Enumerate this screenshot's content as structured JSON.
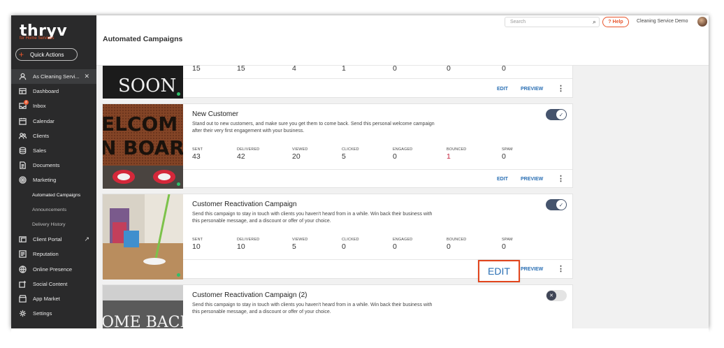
{
  "brand": {
    "name": "thryv",
    "sub": "for Home Services"
  },
  "quick_actions": "Quick Actions",
  "sidebar": {
    "items": [
      {
        "label": "As Cleaning Servi...",
        "icon": "user-switch-icon",
        "active": true
      },
      {
        "label": "Dashboard",
        "icon": "dashboard-icon"
      },
      {
        "label": "Inbox",
        "icon": "inbox-icon",
        "badge": "8"
      },
      {
        "label": "Calendar",
        "icon": "calendar-icon"
      },
      {
        "label": "Clients",
        "icon": "clients-icon"
      },
      {
        "label": "Sales",
        "icon": "sales-icon"
      },
      {
        "label": "Documents",
        "icon": "documents-icon"
      },
      {
        "label": "Marketing",
        "icon": "marketing-icon"
      }
    ],
    "sub_items": [
      "Automated Campaigns",
      "Announcements",
      "Delivery History"
    ],
    "items2": [
      {
        "label": "Client Portal",
        "icon": "client-portal-icon"
      },
      {
        "label": "Reputation",
        "icon": "reputation-icon"
      },
      {
        "label": "Online Presence",
        "icon": "globe-icon"
      },
      {
        "label": "Social Content",
        "icon": "social-icon"
      },
      {
        "label": "App Market",
        "icon": "app-market-icon"
      },
      {
        "label": "Settings",
        "icon": "settings-icon"
      }
    ]
  },
  "topbar": {
    "search_placeholder": "Search",
    "help": "? Help",
    "account": "Cleaning Service Demo"
  },
  "page_title": "Automated Campaigns",
  "stat_labels": [
    "SENT",
    "DELIVERED",
    "VIEWED",
    "CLICKED",
    "ENGAGED",
    "BOUNCED",
    "SPAM"
  ],
  "actions": {
    "edit": "EDIT",
    "preview": "PREVIEW",
    "more": "⋮"
  },
  "thumbs": {
    "card0": "SOON",
    "card1": "ELCOM N BOAR",
    "card3": "OME BACK"
  },
  "cards": [
    {
      "title": "",
      "desc": "",
      "stats": [
        "15",
        "15",
        "4",
        "1",
        "0",
        "0",
        "0"
      ]
    },
    {
      "title": "New Customer",
      "desc": "Stand out to new customers, and make sure you get them to come back. Send this personal welcome campaign after their very first engagement with your business.",
      "enabled": true,
      "stats": [
        "43",
        "42",
        "20",
        "5",
        "0",
        "1",
        "0"
      ]
    },
    {
      "title": "Customer Reactivation Campaign",
      "desc": "Send this campaign to stay in touch with clients you haven't heard from in a while. Win back their business with this personable message, and a discount or offer of your choice.",
      "enabled": true,
      "stats": [
        "10",
        "10",
        "5",
        "0",
        "0",
        "0",
        "0"
      ]
    },
    {
      "title": "Customer Reactivation Campaign (2)",
      "desc": "Send this campaign to stay in touch with clients you haven't heard from in a while. Win back their business with this personable message, and a discount or offer of your choice.",
      "enabled": false
    }
  ],
  "colors": {
    "accent": "#e8552c",
    "link": "#2a6fb4",
    "toggle_on": "#45546d",
    "bounced": "#c3203b",
    "highlight": "#e2451d"
  }
}
